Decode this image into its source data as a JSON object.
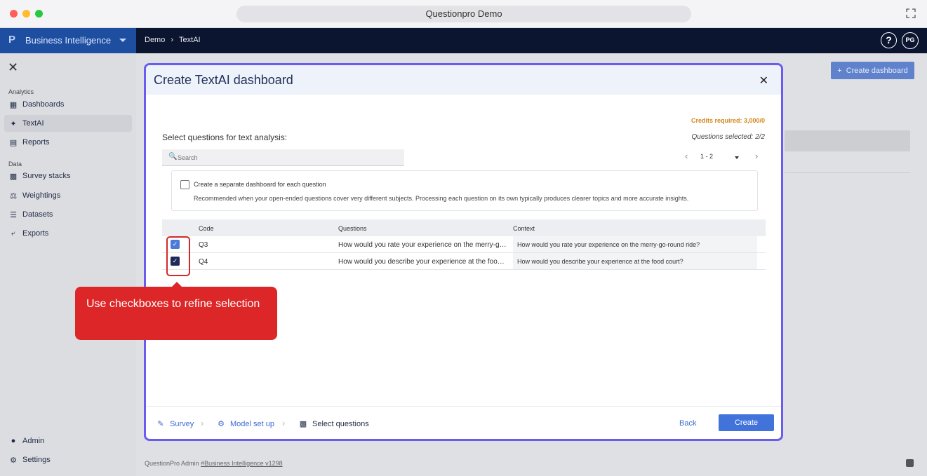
{
  "browser": {
    "title": "Questionpro Demo",
    "dots": [
      "#ff5f57",
      "#febc2e",
      "#28c840"
    ]
  },
  "topbar": {
    "logo": "P",
    "product": "Business Intelligence",
    "breadcrumb": [
      "Demo",
      "TextAI"
    ],
    "help": "?",
    "avatar": "PG"
  },
  "sidebar": {
    "sections": [
      {
        "title": "Analytics",
        "items": [
          {
            "label": "Dashboards",
            "icon": "dashboard-icon"
          },
          {
            "label": "TextAI",
            "icon": "sparkle-icon",
            "active": true
          },
          {
            "label": "Reports",
            "icon": "report-icon"
          }
        ]
      },
      {
        "title": "Data",
        "items": [
          {
            "label": "Survey stacks",
            "icon": "stack-icon"
          },
          {
            "label": "Weightings",
            "icon": "scale-icon"
          },
          {
            "label": "Datasets",
            "icon": "list-icon"
          },
          {
            "label": "Exports",
            "icon": "export-icon"
          }
        ]
      }
    ],
    "bottom": [
      {
        "label": "Admin",
        "icon": "shield-icon"
      },
      {
        "label": "Settings",
        "icon": "gear-icon"
      }
    ]
  },
  "background": {
    "create_dashboard": "Create dashboard"
  },
  "footer": {
    "prefix": "QuestionPro Admin",
    "version": "#Business Intelligence v1298"
  },
  "modal": {
    "title": "Create TextAI dashboard",
    "credits": "Credits required: 3,000/0",
    "questions_selected": "Questions selected: 2/2",
    "select_label": "Select questions for text analysis:",
    "search_placeholder": "Search",
    "pager_range": "1 - 2",
    "option": {
      "label": "Create a separate dashboard for each question",
      "description": "Recommended when your open-ended questions cover very different subjects. Processing each question on its own typically produces clearer topics and more accurate insights.",
      "checked": false
    },
    "table": {
      "headers": [
        "Code",
        "Questions",
        "Context"
      ],
      "rows": [
        {
          "code": "Q3",
          "question": "How would you rate your experience on the merry-go-round ride?",
          "context": "How would you rate your experience on the merry-go-round ride?",
          "checked": true,
          "check_color": "#4a7bd8"
        },
        {
          "code": "Q4",
          "question": "How would you describe your experience at the food court?",
          "context": "How would you describe your experience at the food court?",
          "checked": true,
          "check_color": "#202a5a"
        }
      ]
    },
    "steps": [
      {
        "label": "Survey",
        "icon": "survey-icon",
        "state": "done"
      },
      {
        "label": "Model set up",
        "icon": "gear-icon",
        "state": "done"
      },
      {
        "label": "Select questions",
        "icon": "chat-icon",
        "state": "current"
      }
    ],
    "back": "Back",
    "create": "Create"
  },
  "callout": {
    "text": "Use checkboxes to refine selection",
    "color": "#dd2627"
  }
}
